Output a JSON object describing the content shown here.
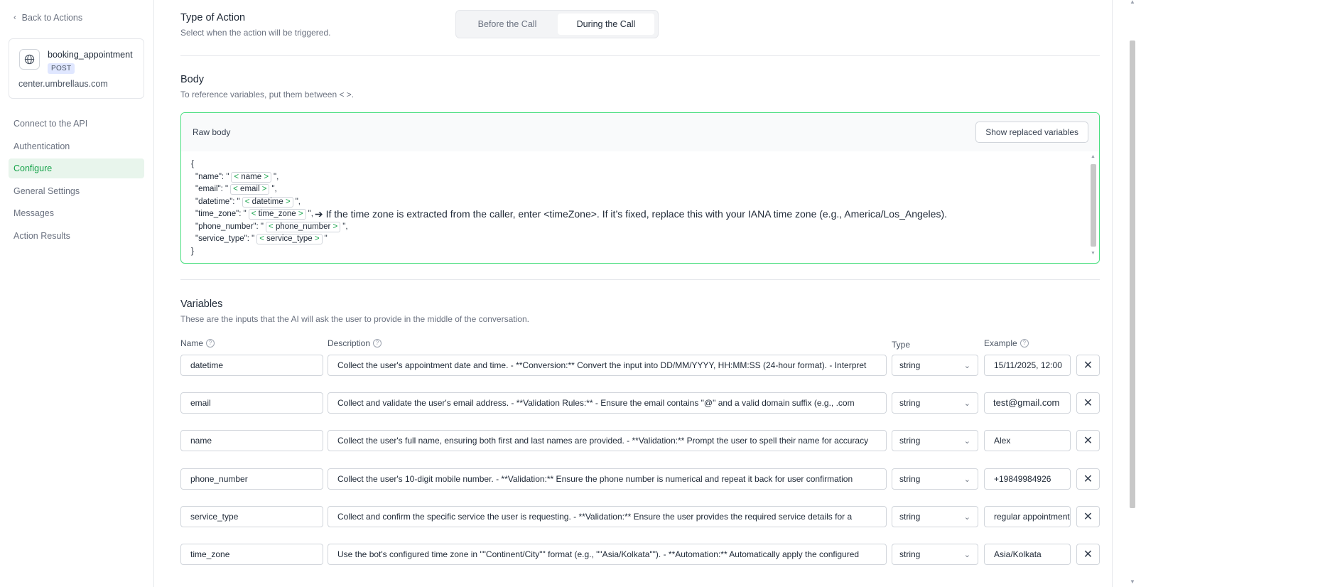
{
  "sidebar": {
    "back_label": "Back to Actions",
    "api": {
      "name": "booking_appointment",
      "method": "POST",
      "domain": "center.umbrellaus.com"
    },
    "items": [
      {
        "label": "Connect to the API",
        "active": false
      },
      {
        "label": "Authentication",
        "active": false
      },
      {
        "label": "Configure",
        "active": true
      },
      {
        "label": "General Settings",
        "active": false
      },
      {
        "label": "Messages",
        "active": false
      },
      {
        "label": "Action Results",
        "active": false
      }
    ]
  },
  "action_type": {
    "title": "Type of Action",
    "subtitle": "Select when the action will be triggered.",
    "options": [
      "Before the Call",
      "During the Call"
    ],
    "selected": "During the Call"
  },
  "body": {
    "title": "Body",
    "subtitle": "To reference variables, put them between < >.",
    "raw_label": "Raw body",
    "show_button": "Show replaced variables",
    "open_brace": "{",
    "close_brace": "}",
    "lines": [
      {
        "key": "\"name\": \"",
        "var": "name",
        "tail": "\","
      },
      {
        "key": "\"email\": \"",
        "var": "email",
        "tail": "\","
      },
      {
        "key": "\"datetime\": \"",
        "var": "datetime",
        "tail": "\","
      },
      {
        "key": "\"time_zone\": \"",
        "var": "time_zone",
        "tail": "\","
      },
      {
        "key": "\"phone_number\": \"",
        "var": "phone_number",
        "tail": "\","
      },
      {
        "key": "\"service_type\": \"",
        "var": "service_type",
        "tail": "\""
      }
    ],
    "timezone_note": "If the time zone is extracted from the caller, enter <timeZone>. If it’s fixed, replace this with your IANA time zone (e.g., America/Los_Angeles)."
  },
  "variables": {
    "title": "Variables",
    "subtitle": "These are the inputs that the AI will ask the user to provide in the middle of the conversation.",
    "headers": {
      "name": "Name",
      "description": "Description",
      "type": "Type",
      "example": "Example"
    },
    "rows": [
      {
        "name": "datetime",
        "description": "Collect the user's appointment date and time. - **Conversion:** Convert the input into DD/MM/YYYY, HH:MM:SS (24-hour format).  - Interpret",
        "type": "string",
        "example": "15/11/2025, 12:00"
      },
      {
        "name": "email",
        "description": "Collect and validate the user's email address. - **Validation Rules:**   - Ensure the email contains \"@\" and a valid domain suffix (e.g., .com",
        "type": "string",
        "example": "test@gmail.com"
      },
      {
        "name": "name",
        "description": "Collect the user's full name, ensuring both first and last names are provided. - **Validation:** Prompt the user to spell their name for accuracy",
        "type": "string",
        "example": "Alex"
      },
      {
        "name": "phone_number",
        "description": "Collect the user's 10-digit mobile number. - **Validation:** Ensure the phone number is numerical and repeat it back for user confirmation",
        "type": "string",
        "example": "+19849984926"
      },
      {
        "name": "service_type",
        "description": "Collect and confirm the specific service the user is requesting. - **Validation:** Ensure the user provides the required service details for a",
        "type": "string",
        "example": "regular appointment"
      },
      {
        "name": "time_zone",
        "description": "Use the bot's configured time zone in \"\"Continent/City\"\" format (e.g., \"\"Asia/Kolkata\"\"). - **Automation:** Automatically apply the configured",
        "type": "string",
        "example": "Asia/Kolkata"
      }
    ]
  },
  "colors": {
    "accent": "#16a34a",
    "accent_bg": "#e8f5ec",
    "border_active": "#4ade80"
  }
}
